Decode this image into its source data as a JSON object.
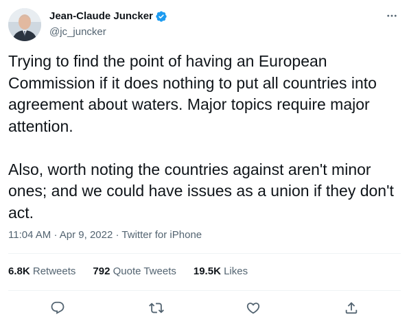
{
  "author": {
    "display_name": "Jean-Claude Juncker",
    "handle": "@jc_juncker",
    "verified": true
  },
  "tweet": {
    "text": "Trying to find the point of having an European Commission if it does nothing to put all countries into agreement about waters. Major topics require major attention.\n\nAlso, worth noting the countries against aren't minor ones; and we could have issues as a union if they don't act.",
    "time": "11:04 AM",
    "date": "Apr 9, 2022",
    "source": "Twitter for iPhone",
    "separator": "·"
  },
  "stats": {
    "retweets_count": "6.8K",
    "retweets_label": "Retweets",
    "quotes_count": "792",
    "quotes_label": "Quote Tweets",
    "likes_count": "19.5K",
    "likes_label": "Likes"
  },
  "icons": {
    "more": "more-icon",
    "verified": "verified-badge-icon",
    "reply": "reply-icon",
    "retweet": "retweet-icon",
    "like": "like-icon",
    "share": "share-icon"
  },
  "colors": {
    "text": "#0f1419",
    "secondary": "#536471",
    "verified": "#1d9bf0",
    "divider": "#eff3f4"
  }
}
